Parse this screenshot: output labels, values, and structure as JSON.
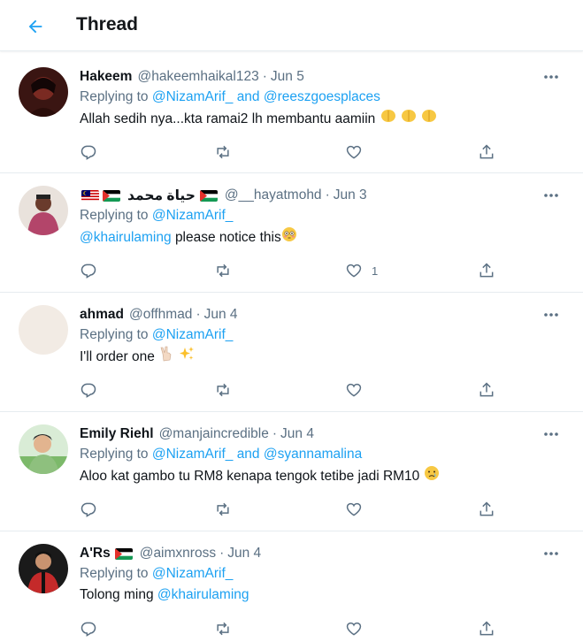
{
  "header": {
    "title": "Thread",
    "back_icon": "arrow-left-icon"
  },
  "colors": {
    "accent": "#1da1f2",
    "muted": "#5b7083",
    "divider": "#e6ecf0"
  },
  "tweets": [
    {
      "name": "Hakeem",
      "handle": "@hakeemhaikal123",
      "sep": "·",
      "date": "Jun 5",
      "reply_prefix": "Replying to",
      "reply_to": "@NizamArif_ and @reeszgoesplaces",
      "text": "Allah sedih nya...kta ramai2 lh membantu aamiin",
      "like_count": ""
    },
    {
      "name": "حياة محمد",
      "handle": "@__hayatmohd",
      "sep": "·",
      "date": "Jun 3",
      "reply_prefix": "Replying to",
      "reply_to": "@NizamArif_",
      "mention": "@khairulaming",
      "text": "please notice this",
      "like_count": "1"
    },
    {
      "name": "ahmad",
      "handle": "@offhmad",
      "sep": "·",
      "date": "Jun 4",
      "reply_prefix": "Replying to",
      "reply_to": "@NizamArif_",
      "text": "I'll order one",
      "like_count": ""
    },
    {
      "name": "Emily Riehl",
      "handle": "@manjaincredible",
      "sep": "·",
      "date": "Jun 4",
      "reply_prefix": "Replying to",
      "reply_to": "@NizamArif_ and @syannamalina",
      "text": "Aloo kat gambo tu RM8 kenapa tengok tetibe jadi RM10",
      "like_count": ""
    },
    {
      "name": "A'Rs",
      "handle": "@aimxnross",
      "sep": "·",
      "date": "Jun 4",
      "reply_prefix": "Replying to",
      "reply_to": "@NizamArif_",
      "text_prefix": "Tolong ming",
      "mention": "@khairulaming",
      "like_count": ""
    }
  ]
}
